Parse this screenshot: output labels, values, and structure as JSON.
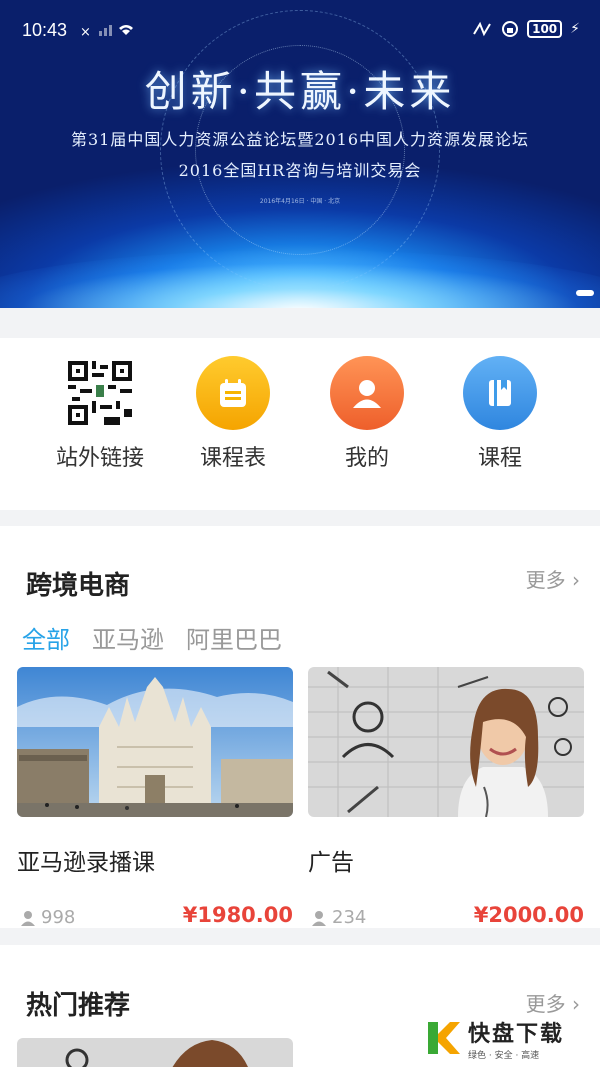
{
  "status_bar": {
    "time": "10:43",
    "signal": "×",
    "battery": "100"
  },
  "banner": {
    "title": "创新·共赢·未来",
    "subtitle_line1": "第31届中国人力资源公益论坛暨2016中国人力资源发展论坛",
    "subtitle_line2": "2016全国HR咨询与培训交易会",
    "small_text": "2016年4月16日 · 中国 · 北京"
  },
  "quick_menu": [
    {
      "label": "站外链接",
      "icon": "qr-code-icon"
    },
    {
      "label": "课程表",
      "icon": "calendar-icon",
      "color": "#f7b500"
    },
    {
      "label": "我的",
      "icon": "user-icon",
      "color": "#f2743a"
    },
    {
      "label": "课程",
      "icon": "book-icon",
      "color": "#3f9ce9"
    }
  ],
  "cross_border": {
    "title": "跨境电商",
    "more": "更多",
    "tabs": [
      "全部",
      "亚马逊",
      "阿里巴巴"
    ],
    "active_tab": "全部",
    "courses": [
      {
        "name": "亚马逊录播课",
        "views": "998",
        "price": "¥1980.00",
        "image": "milan-cathedral"
      },
      {
        "name": "广告",
        "views": "234",
        "price": "¥2000.00",
        "image": "woman-doctor"
      }
    ]
  },
  "hot": {
    "title": "热门推荐",
    "more": "更多"
  },
  "watermark": {
    "brand": "快盘下载",
    "slogan": "绿色 · 安全 · 高速"
  },
  "colors": {
    "accent": "#27a3e8",
    "price": "#e8443a"
  }
}
